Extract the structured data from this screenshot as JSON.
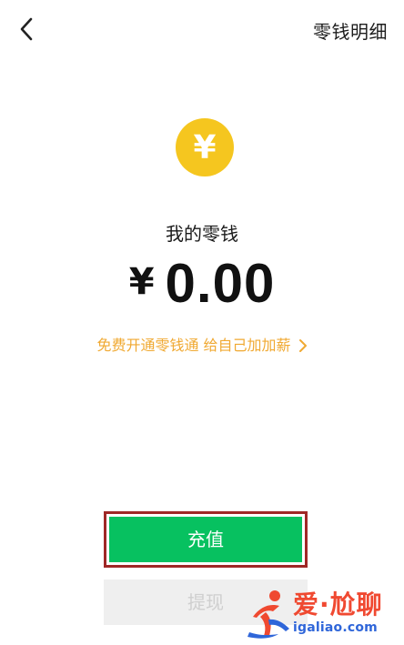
{
  "header": {
    "back_icon": "chevron-left-icon",
    "detail_label": "零钱明细"
  },
  "wallet": {
    "icon": "yuan-coin-icon",
    "icon_symbol": "¥",
    "label": "我的零钱",
    "currency_symbol": "¥",
    "amount": "0.00"
  },
  "promo": {
    "text": "免费开通零钱通 给自己加加薪",
    "arrow_icon": "chevron-right-icon"
  },
  "actions": {
    "recharge_label": "充值",
    "withdraw_label": "提现"
  },
  "watermark": {
    "logo_icon": "runner-logo-icon",
    "title": "爱·尬聊",
    "site": "igaliao.com"
  },
  "colors": {
    "coin_yellow": "#f5c61f",
    "recharge_green": "#07c160",
    "promo_orange": "#f0a932",
    "highlight_red": "#9f2826",
    "withdraw_bg": "#efefef",
    "withdraw_text": "#cfcfcf",
    "watermark_red": "#f0462d",
    "watermark_blue": "#2b63d9"
  }
}
